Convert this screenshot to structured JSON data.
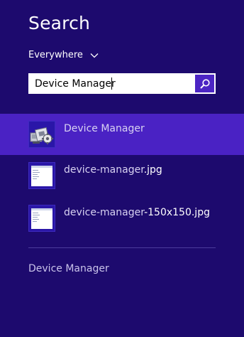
{
  "header": {
    "title": "Search"
  },
  "scope": {
    "label": "Everywhere",
    "icon": "chevron-down-icon"
  },
  "search": {
    "value": "Device Manager",
    "button_icon": "search-icon"
  },
  "results": [
    {
      "kind": "app",
      "icon": "device-manager-app-icon",
      "match": "Device Manager",
      "rest": "",
      "selected": true
    },
    {
      "kind": "image",
      "icon": "image-thumbnail-icon",
      "match": "device-manager",
      "rest": ".jpg",
      "selected": false
    },
    {
      "kind": "image",
      "icon": "image-thumbnail-icon",
      "match": "device-manager",
      "rest": "-150x150.jpg",
      "selected": false
    }
  ],
  "suggestions": [
    {
      "label": "Device Manager"
    }
  ],
  "colors": {
    "background": "#1d0a6e",
    "selected_row": "#4a22c4",
    "search_button": "#4c25c4"
  }
}
